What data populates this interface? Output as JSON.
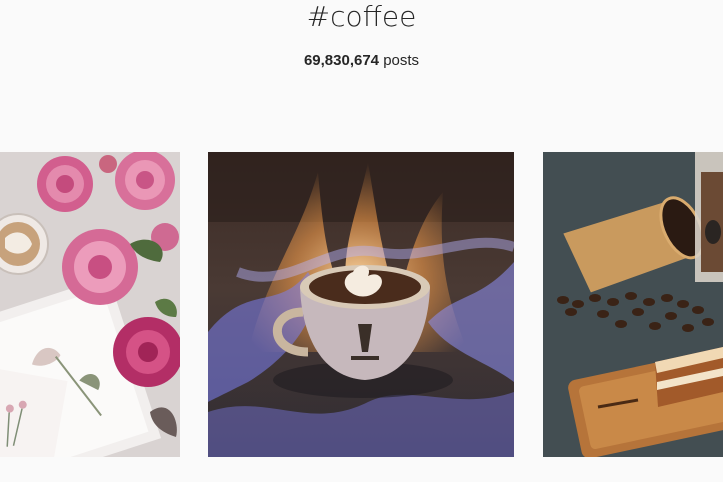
{
  "header": {
    "hashtag": "#coffee",
    "post_count_number": "69,830,674",
    "post_count_label": "posts"
  },
  "posts": [
    {
      "subject": "peony-flowers-latte-postcards-image"
    },
    {
      "subject": "flaming-latte-cup-image"
    },
    {
      "subject": "spilled-coffee-beans-cake-image"
    }
  ],
  "colors": {
    "background": "#fafafa",
    "text": "#262626"
  }
}
